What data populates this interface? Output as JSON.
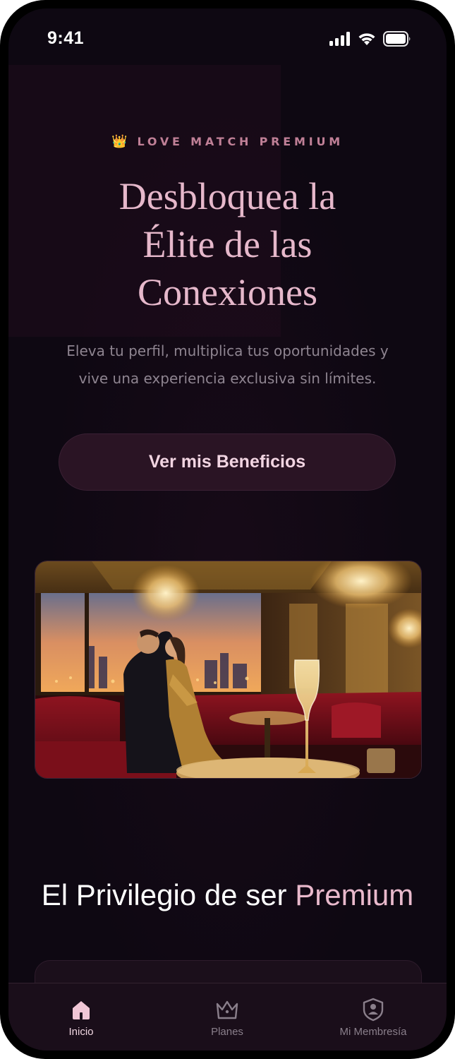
{
  "status_bar": {
    "time": "9:41",
    "icons": [
      "signal-icon",
      "wifi-icon",
      "battery-icon"
    ]
  },
  "hero": {
    "eyebrow_icon": "👑",
    "eyebrow": "LOVE MATCH PREMIUM",
    "headline_lines": [
      "Desbloquea la",
      "Élite de las",
      "Conexiones"
    ],
    "subtitle_lines": [
      "Eleva tu perfil, multiplica tus oportunidades y",
      "vive una experiencia exclusiva sin límites."
    ],
    "cta_label": "Ver mis Beneficios"
  },
  "section": {
    "title_main": "El Privilegio de ser ",
    "title_accent": "Premium"
  },
  "tabbar": {
    "items": [
      {
        "label": "Inicio",
        "icon": "home-icon",
        "active": true
      },
      {
        "label": "Planes",
        "icon": "crown-icon",
        "active": false
      },
      {
        "label": "Mi Membresía",
        "icon": "member-badge-icon",
        "active": false
      }
    ]
  },
  "colors": {
    "background": "#0e0812",
    "accent_pink": "#e6b8cb",
    "cta_bg": "#2a1424",
    "tabbar_bg": "#1a0e1a"
  }
}
